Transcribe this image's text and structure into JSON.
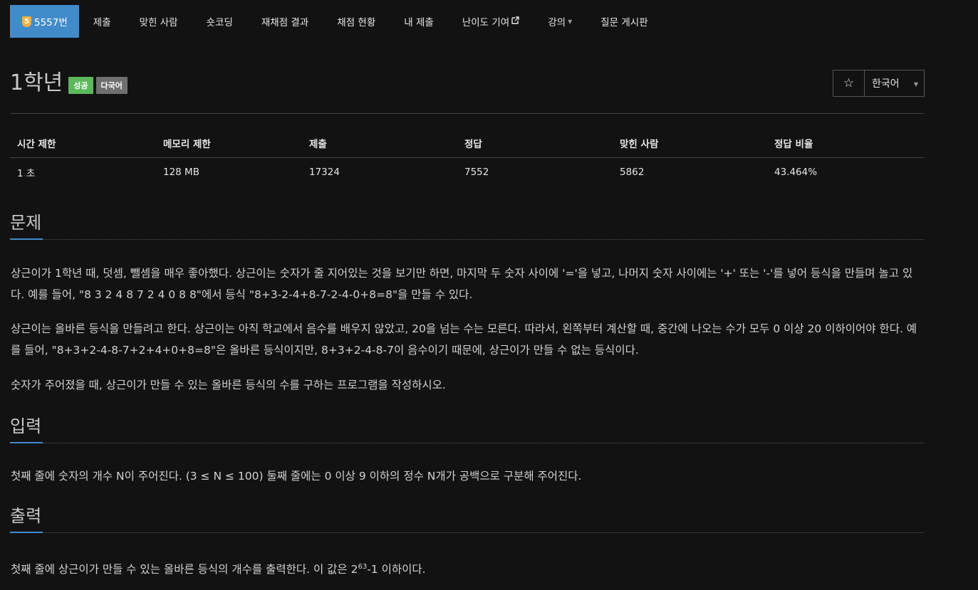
{
  "nav": {
    "problem_badge": "5",
    "problem_number": "5557번",
    "items": [
      {
        "label": "제출"
      },
      {
        "label": "맞힌 사람"
      },
      {
        "label": "숏코딩"
      },
      {
        "label": "재채점 결과"
      },
      {
        "label": "채점 현황"
      },
      {
        "label": "내 제출"
      },
      {
        "label": "난이도 기여"
      },
      {
        "label": "강의"
      },
      {
        "label": "질문 게시판"
      }
    ]
  },
  "problem": {
    "title": "1학년",
    "labels": {
      "success": "성공",
      "multilang": "다국어"
    },
    "star": "☆",
    "language": "한국어"
  },
  "stats": {
    "headers": [
      "시간 제한",
      "메모리 제한",
      "제출",
      "정답",
      "맞힌 사람",
      "정답 비율"
    ],
    "values": [
      "1 초",
      "128 MB",
      "17324",
      "7552",
      "5862",
      "43.464%"
    ]
  },
  "sections": {
    "description": {
      "title": "문제",
      "paragraphs": [
        "상근이가 1학년 때, 덧셈, 뺄셈을 매우 좋아했다. 상근이는 숫자가 줄 지어있는 것을 보기만 하면, 마지막 두 숫자 사이에 '='을 넣고, 나머지 숫자 사이에는 '+' 또는 '-'를 넣어 등식을 만들며 놀고 있다. 예를 들어, \"8 3 2 4 8 7 2 4 0 8 8\"에서 등식 \"8+3-2-4+8-7-2-4-0+8=8\"을 만들 수 있다.",
        "상근이는 올바른 등식을 만들려고 한다. 상근이는 아직 학교에서 음수를 배우지 않았고, 20을 넘는 수는 모른다. 따라서, 왼쪽부터 계산할 때, 중간에 나오는 수가 모두 0 이상 20 이하이어야 한다. 예를 들어, \"8+3+2-4-8-7+2+4+0+8=8\"은 올바른 등식이지만, 8+3+2-4-8-7이 음수이기 때문에, 상근이가 만들 수 없는 등식이다.",
        "숫자가 주어졌을 때, 상근이가 만들 수 있는 올바른 등식의 수를 구하는 프로그램을 작성하시오."
      ]
    },
    "input": {
      "title": "입력",
      "text": "첫째 줄에 숫자의 개수 N이 주어진다. (3 ≤ N ≤ 100) 둘째 줄에는 0 이상 9 이하의 정수 N개가 공백으로 구분해 주어진다."
    },
    "output": {
      "title": "출력",
      "text_before": "첫째 줄에 상근이가 만들 수 있는 올바른 등식의 개수를 출력한다. 이 값은 2",
      "sup": "63",
      "text_after": "-1 이하이다."
    }
  }
}
